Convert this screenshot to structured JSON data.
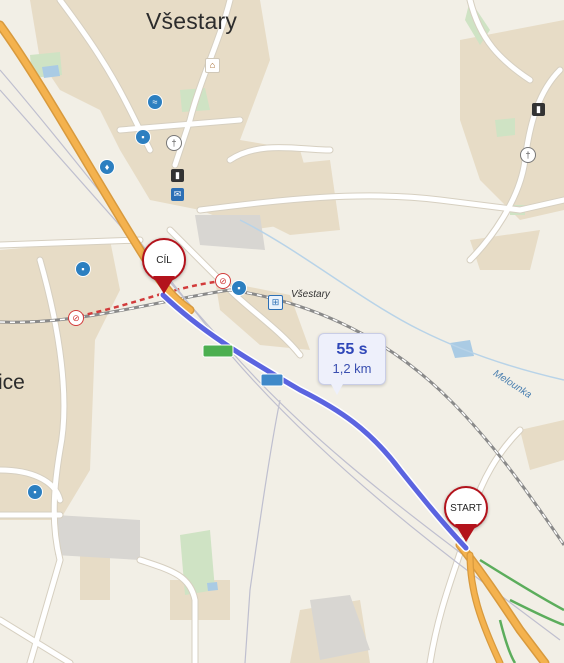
{
  "map": {
    "town_label": "Všestary",
    "partial_town_label": "ice",
    "station_label": "Všestary",
    "stream_label": "Melounka",
    "road_badges": [
      "",
      ""
    ],
    "colors": {
      "route": "#5b64e0",
      "pin_red": "#b3131c",
      "rail_red": "#d23b3b",
      "highway": "#f4b24e",
      "green_road": "#5cad5c"
    }
  },
  "route_callout": {
    "time": "55 s",
    "distance": "1,2 km"
  },
  "markers": {
    "destination_label": "CÍL",
    "start_label": "START"
  },
  "icons": [
    "home-icon",
    "swimming-icon",
    "bus-stop-icon",
    "fountain-icon",
    "church-icon",
    "post-office-icon",
    "castle-icon",
    "railway-station-icon",
    "no-crossing-icon"
  ]
}
